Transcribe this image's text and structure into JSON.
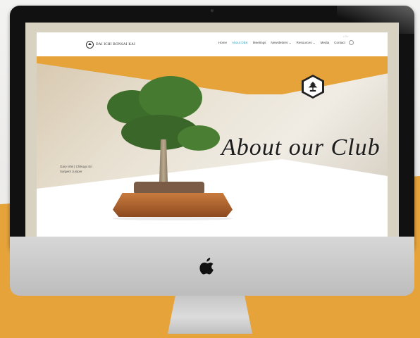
{
  "site": {
    "logo_text": "DAI ICHI BONSAI KAI",
    "nav": [
      "Home",
      "About DBK",
      "Meetings",
      "Newsletters ⌄",
      "Resources ⌄",
      "Media",
      "Contact"
    ],
    "active_nav_index": 1,
    "social": "f  G+",
    "hero_title": "About our Club",
    "caption_line1": "Gary Ishii  |  Chikugo En",
    "caption_line2": "Sargent Juniper"
  },
  "colors": {
    "accent_orange": "#e6a33a",
    "active_link": "#2fa6c7",
    "monitor_bezel": "#111111"
  }
}
